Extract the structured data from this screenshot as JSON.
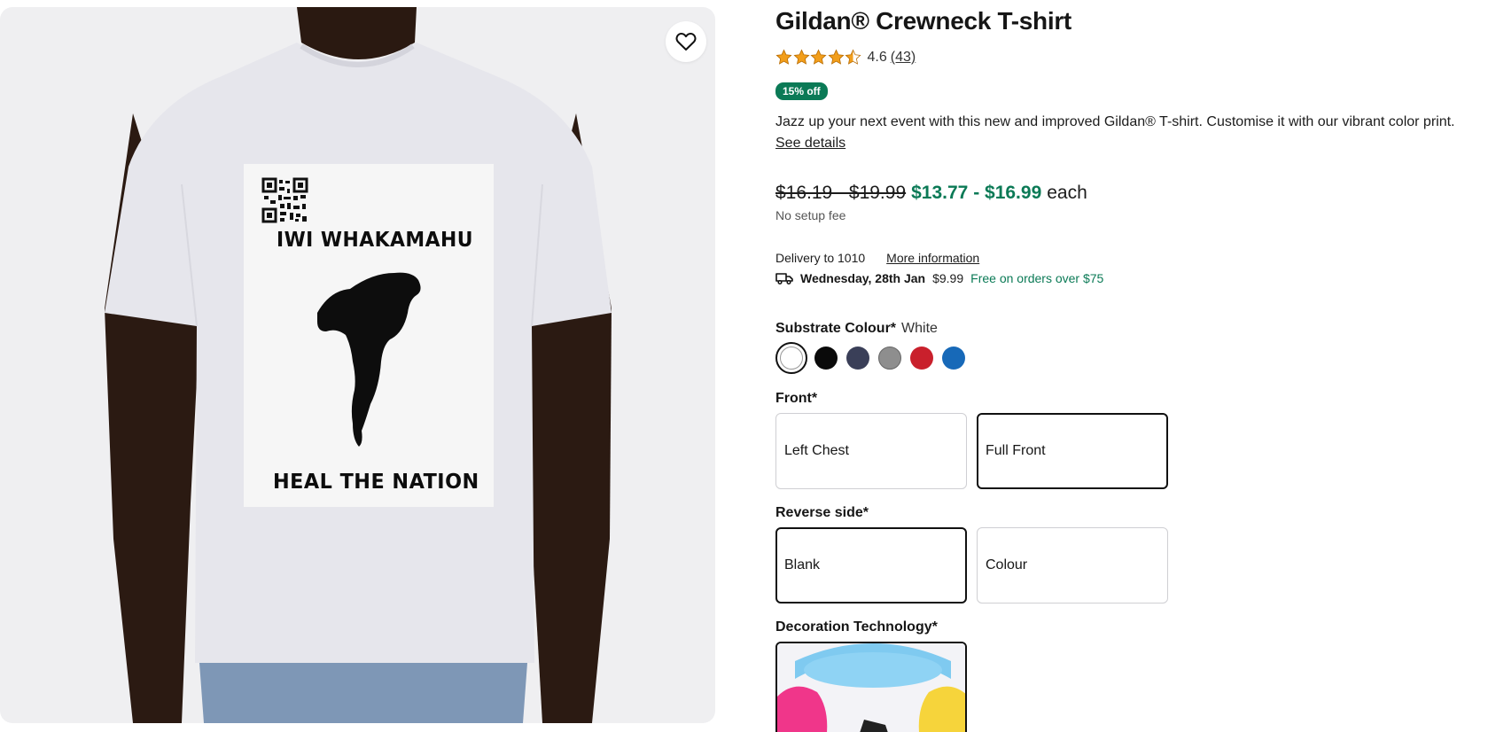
{
  "image": {
    "shirt_print": {
      "top_text": "IWI WHAKAMAHU",
      "bottom_text": "HEAL THE NATION"
    },
    "favorite_icon": "heart-outline-icon"
  },
  "product": {
    "title": "Gildan® Crewneck T-shirt",
    "rating": {
      "value": "4.6",
      "count": "(43)",
      "stars": 4.5,
      "star_color": "#f29e1b"
    },
    "badge": "15% off",
    "description": "Jazz up your next event with this new and improved Gildan® T-shirt. Customise it with our vibrant color print.",
    "see_details": "See details",
    "price": {
      "original": "$16.19 - $19.99",
      "sale": "$13.77 - $16.99",
      "unit": "each",
      "setup_note": "No setup fee",
      "sale_color": "#0b7a56"
    },
    "delivery": {
      "label": "Delivery to 1010",
      "more_info": "More information",
      "date": "Wednesday, 28th Jan",
      "cost": "$9.99",
      "free_note": "Free on orders over $75",
      "icon": "delivery-truck-icon"
    },
    "substrate": {
      "label": "Substrate Colour*",
      "selected": "White",
      "colors": [
        "#ffffff",
        "#0a0a0a",
        "#3a3f58",
        "#8e8e8e",
        "#c9202c",
        "#1769b8"
      ]
    },
    "front": {
      "label": "Front*",
      "options": [
        "Left Chest",
        "Full Front"
      ],
      "selected": "Full Front"
    },
    "reverse": {
      "label": "Reverse side*",
      "options": [
        "Blank",
        "Colour"
      ],
      "selected": "Blank"
    },
    "decoration": {
      "label": "Decoration Technology*"
    }
  }
}
